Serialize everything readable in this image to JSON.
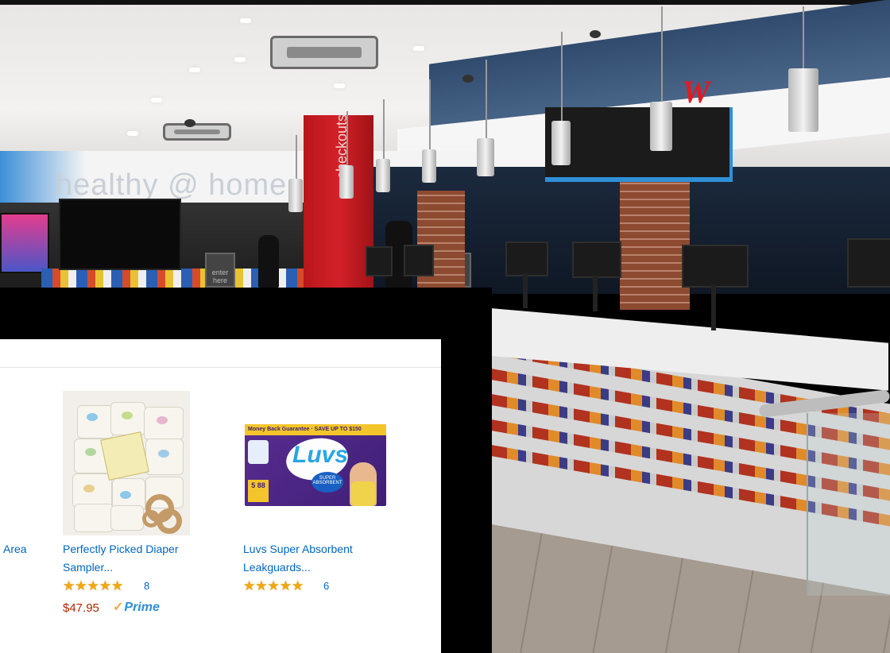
{
  "photo": {
    "store_sign": "healthy @ home",
    "pillar_sign": "checkouts",
    "lane_sign_1": "enter here",
    "lane_sign_2": "enter here",
    "logo": "W"
  },
  "products": [
    {
      "title_line1": "Area",
      "title_line2": ""
    },
    {
      "title_line1": "Perfectly Picked Diaper",
      "title_line2": "Sampler...",
      "stars": "★★★★★",
      "rating_count": "8",
      "price": "$47.95",
      "prime_label": "Prime"
    },
    {
      "title_line1": "Luvs Super Absorbent",
      "title_line2": "Leakguards...",
      "stars": "★★★★★",
      "rating_count": "6",
      "box_banner": "Money Back Guarantee · SAVE UP TO $150",
      "box_brand": "Luvs",
      "box_sub": "SUPER ABSORBENT",
      "box_count": "5 88"
    }
  ],
  "icons": {
    "prime_check": "✓"
  },
  "colors": {
    "link": "#0066c0",
    "price": "#b12704",
    "star": "#f1a80f",
    "prime": "#2a8fd3"
  }
}
